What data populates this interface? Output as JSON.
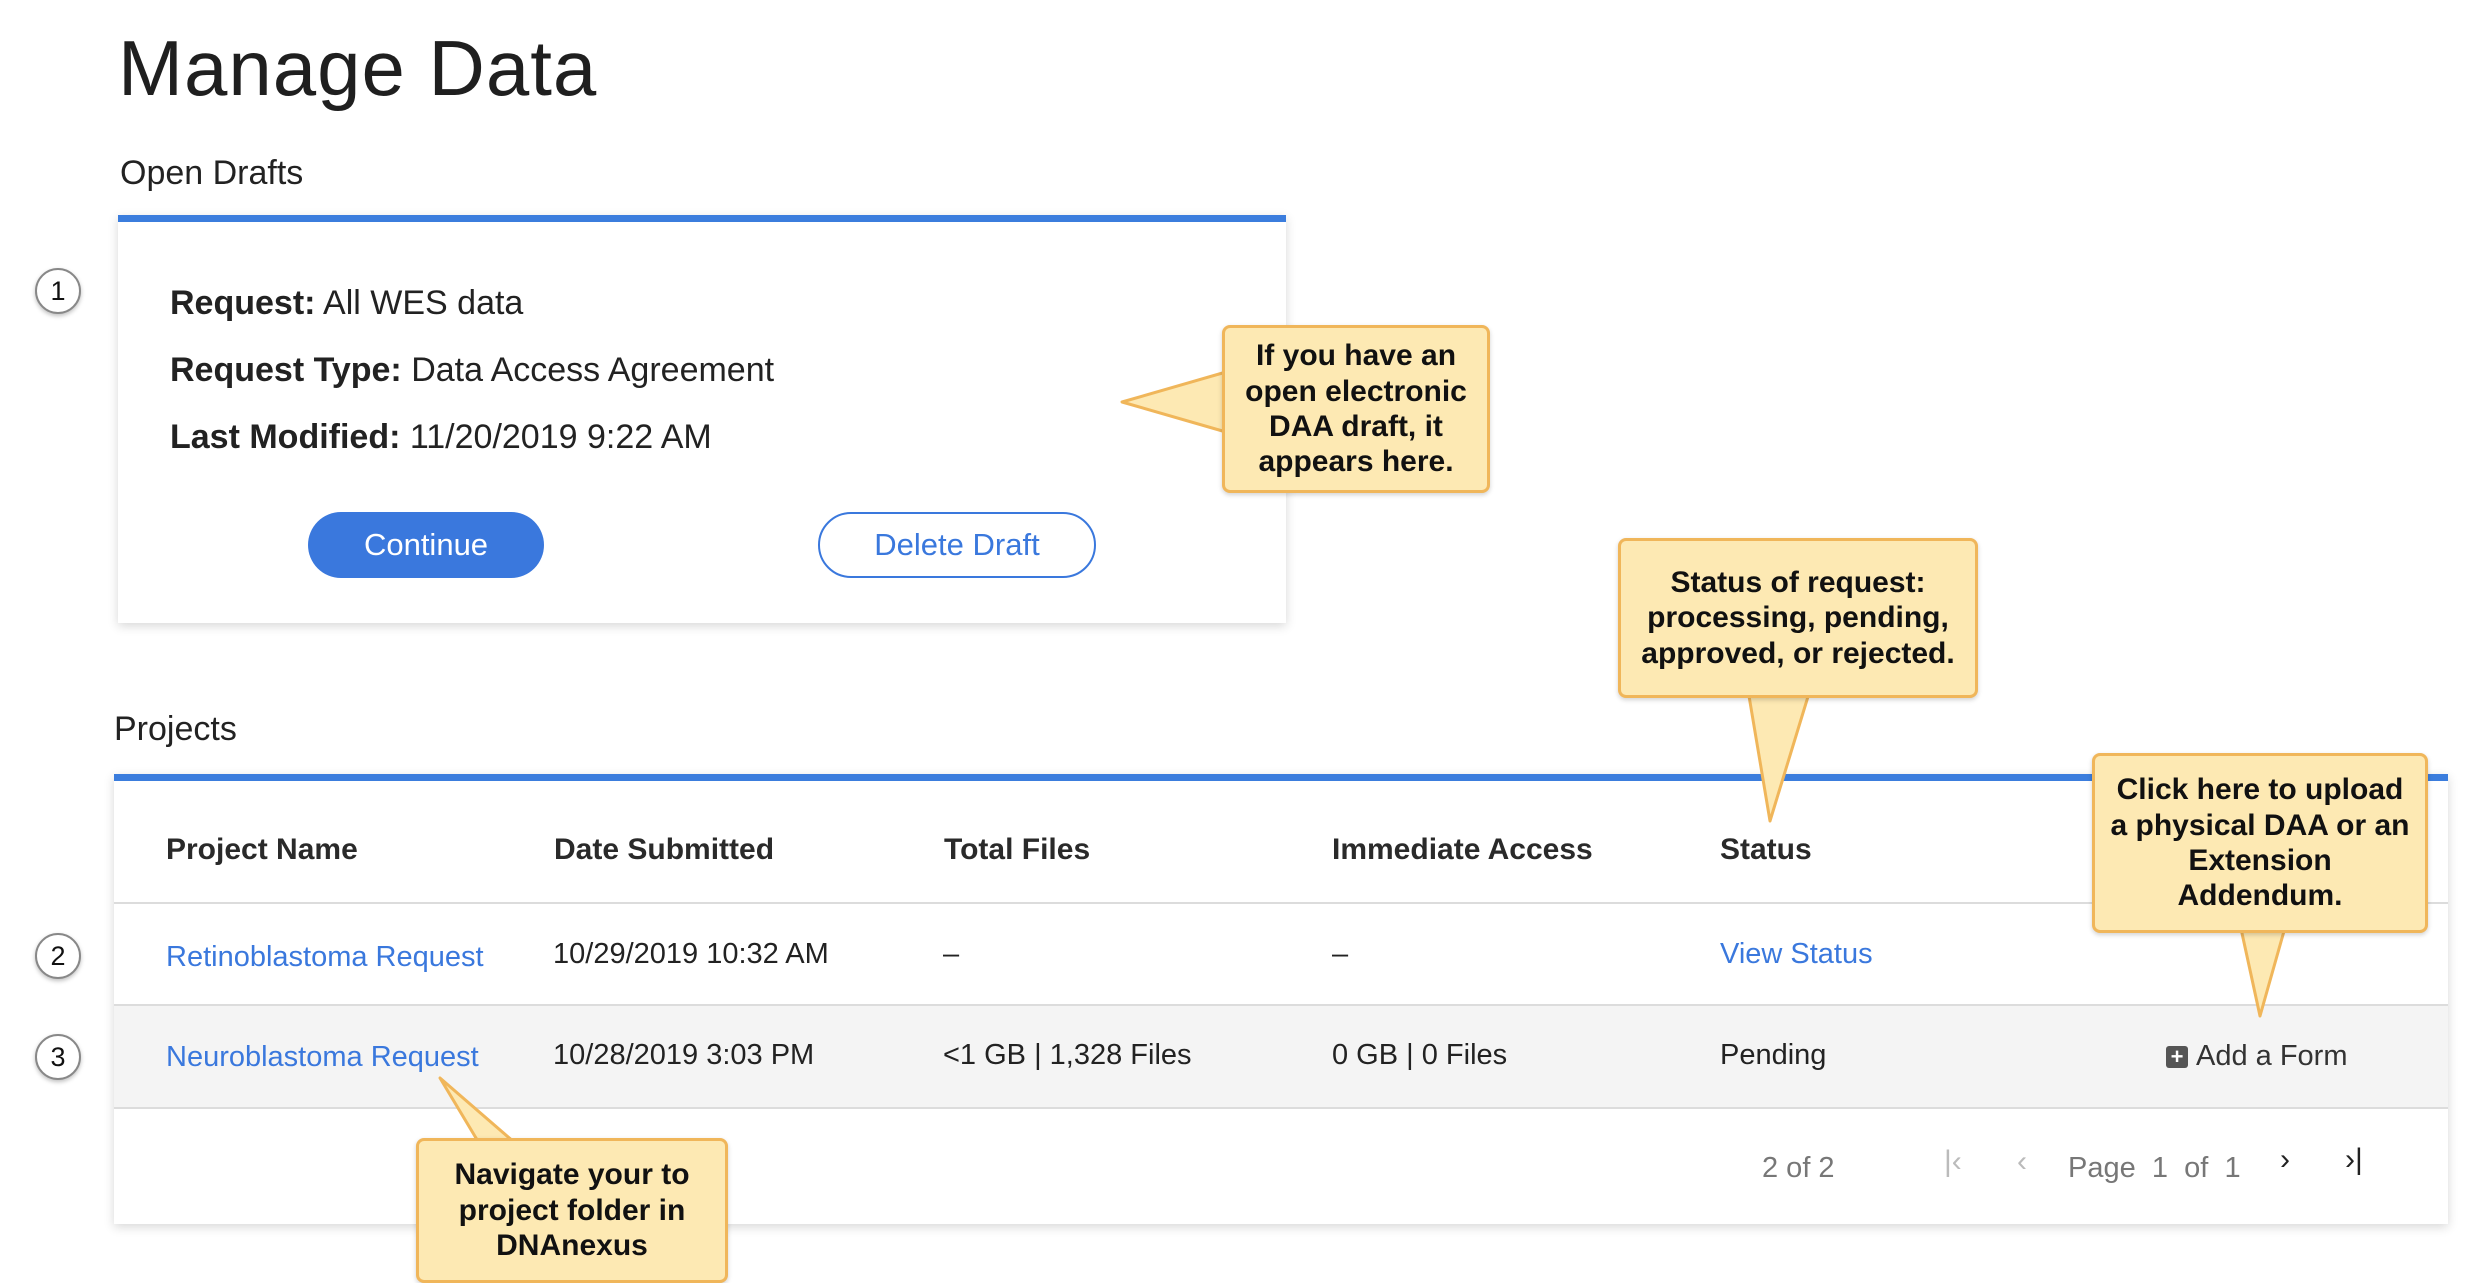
{
  "page": {
    "title": "Manage Data"
  },
  "drafts": {
    "section_title": "Open Drafts",
    "request_label": "Request:",
    "request_value": "All WES data",
    "type_label": "Request Type:",
    "type_value": "Data Access Agreement",
    "modified_label": "Last Modified:",
    "modified_value": "11/20/2019 9:22 AM",
    "continue_label": "Continue",
    "delete_label": "Delete Draft"
  },
  "projects": {
    "section_title": "Projects",
    "columns": [
      "Project Name",
      "Date Submitted",
      "Total Files",
      "Immediate Access",
      "Status"
    ],
    "rows": [
      {
        "name": "Retinoblastoma Request",
        "date": "10/29/2019 10:32 AM",
        "total_files": "–",
        "immediate_access": "–",
        "status": "View Status",
        "action": ""
      },
      {
        "name": "Neuroblastoma Request",
        "date": "10/28/2019 3:03 PM",
        "total_files": "<1 GB | 1,328 Files",
        "immediate_access": "0 GB | 0 Files",
        "status": "Pending",
        "action": "Add a Form"
      }
    ],
    "pager": {
      "count": "2 of 2",
      "page_label": "Page",
      "current_page": "1",
      "of_label": "of",
      "total_pages": "1"
    }
  },
  "markers": [
    "1",
    "2",
    "3"
  ],
  "callouts": {
    "draft": "If you have an open electronic DAA draft, it appears here.",
    "status": "Status of request: processing, pending, approved, or rejected.",
    "upload": "Click here to upload a physical DAA or an Extension Addendum.",
    "navigate": "Navigate your to project folder in DNAnexus"
  },
  "colors": {
    "accent": "#3a78dd",
    "callout_fill": "#fde9b3",
    "callout_border": "#f0b65a"
  },
  "icons": {
    "first_page": "first-page-icon",
    "prev_page": "prev-page-icon",
    "next_page": "next-page-icon",
    "last_page": "last-page-icon",
    "add_form": "plus-square-icon"
  }
}
